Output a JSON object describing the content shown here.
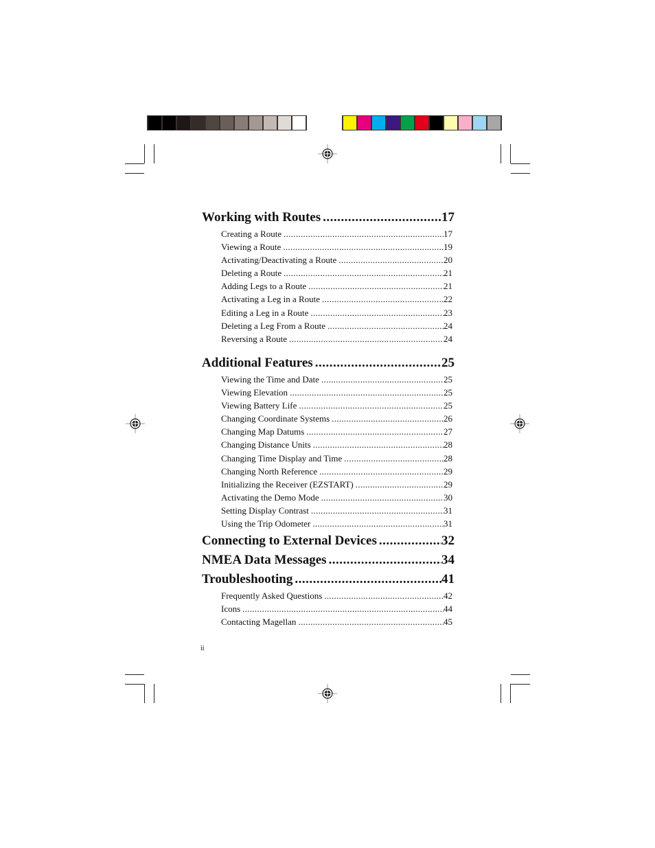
{
  "color_bars": {
    "grayscale": [
      "#000000",
      "#050102",
      "#1c1816",
      "#352c29",
      "#504641",
      "#6a5f58",
      "#877c76",
      "#a49892",
      "#c2b9b3",
      "#e0dbd7",
      "#ffffff"
    ],
    "process": [
      "#fff200",
      "#e6007e",
      "#00aeef",
      "#3a1a7e",
      "#00a14b",
      "#e2001a",
      "#000000",
      "#fffbb0",
      "#f7b0c8",
      "#a0d6f4",
      "#a7a7a7"
    ]
  },
  "toc": [
    {
      "title": "Working with Routes",
      "page": "17",
      "items": [
        {
          "title": "Creating a Route",
          "page": "17"
        },
        {
          "title": "Viewing a Route",
          "page": "19"
        },
        {
          "title": "Activating/Deactivating a Route",
          "page": "20"
        },
        {
          "title": "Deleting a Route",
          "page": "21"
        },
        {
          "title": "Adding Legs to a Route",
          "page": "21"
        },
        {
          "title": "Activating a Leg in a Route",
          "page": "22"
        },
        {
          "title": "Editing a Leg in a Route",
          "page": "23"
        },
        {
          "title": "Deleting a Leg From a Route",
          "page": "24"
        },
        {
          "title": "Reversing a Route",
          "page": "24"
        }
      ]
    },
    {
      "title": "Additional Features",
      "page": "25",
      "items": [
        {
          "title": "Viewing the Time and Date",
          "page": "25"
        },
        {
          "title": "Viewing Elevation",
          "page": "25"
        },
        {
          "title": "Viewing Battery Life",
          "page": "25"
        },
        {
          "title": "Changing Coordinate Systems",
          "page": "26"
        },
        {
          "title": "Changing Map Datums",
          "page": "27"
        },
        {
          "title": "Changing Distance Units",
          "page": "28"
        },
        {
          "title": "Changing Time Display and Time",
          "page": "28"
        },
        {
          "title": "Changing North Reference",
          "page": "29"
        },
        {
          "title": "Initializing the Receiver (EZSTART)",
          "page": "29"
        },
        {
          "title": "Activating the Demo Mode",
          "page": "30"
        },
        {
          "title": "Setting Display Contrast",
          "page": "31"
        },
        {
          "title": "Using the Trip Odometer",
          "page": "31"
        }
      ]
    },
    {
      "title": "Connecting to External Devices",
      "page": "32",
      "items": []
    },
    {
      "title": "NMEA Data Messages",
      "page": "34",
      "items": []
    },
    {
      "title": "Troubleshooting",
      "page": "41",
      "items": [
        {
          "title": "Frequently Asked Questions",
          "page": "42"
        },
        {
          "title": "Icons",
          "page": "44"
        },
        {
          "title": "Contacting Magellan",
          "page": "45"
        }
      ]
    }
  ],
  "folio": "ii"
}
